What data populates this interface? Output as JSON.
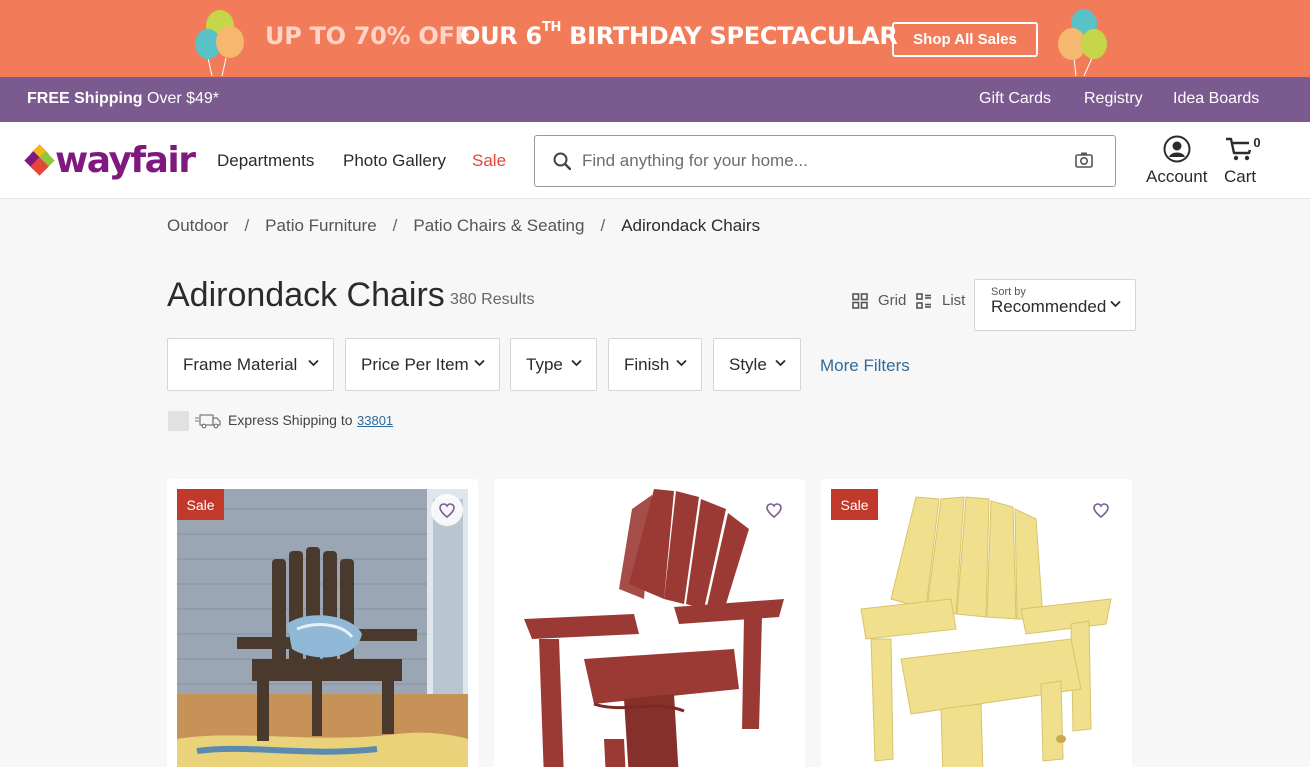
{
  "promo": {
    "discount_text": "UP TO 70% OFF",
    "event_text_pre": "OUR 6",
    "event_text_sup": "TH",
    "event_text_post": " BIRTHDAY SPECTACULAR",
    "cta_label": "Shop All Sales",
    "background_color": "#f27c59"
  },
  "utility_bar": {
    "shipping_bold": "FREE Shipping",
    "shipping_rest": " Over $49*",
    "links": [
      "Gift Cards",
      "Registry",
      "Idea Boards"
    ],
    "background_color": "#7b5a8f"
  },
  "header": {
    "logo_text": "wayfair",
    "nav": [
      "Departments",
      "Photo Gallery",
      "Sale"
    ],
    "search_placeholder": "Find anything for your home...",
    "account_label": "Account",
    "cart_label": "Cart",
    "cart_count": "0",
    "brand_color": "#7f187f"
  },
  "breadcrumb": {
    "items": [
      "Outdoor",
      "Patio Furniture",
      "Patio Chairs & Seating",
      "Adirondack Chairs"
    ],
    "separator": "/"
  },
  "listing": {
    "title": "Adirondack Chairs",
    "result_count": "380 Results",
    "view_grid": "Grid",
    "view_list": "List",
    "sort_caption": "Sort by",
    "sort_value": "Recommended"
  },
  "filters": {
    "items": [
      "Frame Material",
      "Price Per Item",
      "Type",
      "Finish",
      "Style"
    ],
    "more_label": "More Filters"
  },
  "express": {
    "text": "Express Shipping to",
    "zip": "33801"
  },
  "products": [
    {
      "badge": "Sale",
      "image": "dark brown adirondack chair on porch with pillow"
    },
    {
      "badge": "",
      "image": "red adirondack chair"
    },
    {
      "badge": "Sale",
      "image": "natural pine adirondack chair"
    }
  ]
}
